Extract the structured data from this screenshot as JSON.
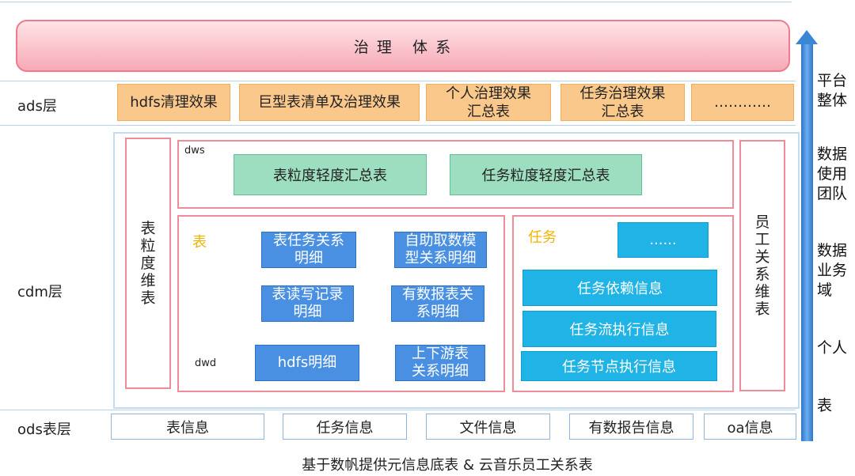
{
  "banner": {
    "title": "治 理   体 系"
  },
  "layers": {
    "ads": "ads层",
    "cdm": "cdm层",
    "ods": "ods表层"
  },
  "ads_boxes": [
    {
      "label": "hdfs清理效果"
    },
    {
      "label": "巨型表清单及治理效果"
    },
    {
      "line1": "个人治理效果",
      "line2": "汇总表"
    },
    {
      "line1": "任务治理效果",
      "line2": "汇总表"
    },
    {
      "label": "…………"
    }
  ],
  "cdm": {
    "left_dim": "表粒度维表",
    "right_dim": "员工关系维表",
    "dws": {
      "tag": "dws",
      "boxes": [
        "表粒度轻度汇总表",
        "任务粒度轻度汇总表"
      ]
    },
    "dwd": {
      "tag": "dwd",
      "table_group": {
        "title": "表",
        "boxes": [
          {
            "line1": "表任务关系",
            "line2": "明细"
          },
          {
            "line1": "自助取数模",
            "line2": "型关系明细"
          },
          {
            "line1": "表读写记录",
            "line2": "明细"
          },
          {
            "line1": "有数报表关",
            "line2": "系明细"
          },
          {
            "line1": "hdfs明细",
            "line2": ""
          },
          {
            "line1": "上下游表",
            "line2": "关系明细"
          }
        ]
      },
      "task_group": {
        "title": "任务",
        "boxes": [
          "......",
          "任务依赖信息",
          "任务流执行信息",
          "任务节点执行信息"
        ]
      }
    }
  },
  "ods_boxes": [
    "表信息",
    "任务信息",
    "文件信息",
    "有数报告信息",
    "oa信息"
  ],
  "footer": "基于数帆提供元信息底表 & 云音乐员工关系表",
  "side_labels": [
    "平台\n整体",
    "数据\n使用\n团队",
    "数据\n业务\n域",
    "个人",
    "表"
  ],
  "colors": {
    "banner": "#f6aab6",
    "ads": "#fac88b",
    "dws": "#9ddec0",
    "dwd_table": "#4a90e2",
    "dwd_task": "#1fb3e6",
    "arrow": "#3c86d6",
    "accent_yellow": "#f0b400"
  }
}
